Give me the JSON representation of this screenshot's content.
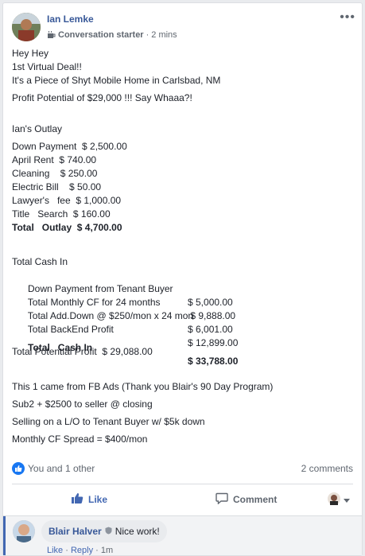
{
  "post": {
    "author": "Ian Lemke",
    "badge": "Conversation starter",
    "separator": "·",
    "time": "2 mins",
    "lines": [
      "Hey Hey",
      "1st Virtual Deal!!",
      "It's a Piece of Shyt Mobile Home in Carlsbad, NM",
      "Profit Potential of $29,000 !!! Say Whaaa?!"
    ],
    "outlay_title": "Ian's Outlay",
    "outlay_items": [
      "Down Payment  $ 2,500.00",
      "April Rent  $ 740.00",
      "Cleaning    $ 250.00",
      "Electric Bill    $ 50.00",
      "Lawyer's   fee  $ 1,000.00",
      "Title   Search  $ 160.00"
    ],
    "outlay_total": "Total   Outlay  $ 4,700.00",
    "cash_title": "Total Cash In",
    "cash_rows": [
      {
        "label": "Down Payment from Tenant Buyer",
        "amount": "$ 5,000.00"
      },
      {
        "label": "Total Monthly CF for 24 months",
        "amount": " $ 9,888.00"
      },
      {
        "label": "Total Add.Down @ $250/mon x 24 mon",
        "amount": "$ 6,001.00"
      },
      {
        "label": "Total BackEnd Profit",
        "amount": "$ 12,899.00"
      }
    ],
    "cash_total_label": "Total   Cash In",
    "cash_total_amount": "$ 33,788.00",
    "potential_profit": "Total Potential Profit  $ 29,088.00",
    "notes": [
      "This 1 came from FB Ads (Thank you Blair's 90 Day Program)",
      "Sub2 + $2500 to seller @ closing",
      "Selling on a L/O to Tenant Buyer w/ $5k down",
      "Monthly CF Spread = $400/mon"
    ]
  },
  "reactions": {
    "summary": "You and 1 other",
    "comments_count": "2 comments"
  },
  "actions": {
    "like": "Like",
    "comment": "Comment"
  },
  "comment": {
    "author": "Blair Halver",
    "text": "Nice work!",
    "like": "Like",
    "reply": "Reply",
    "dot": "·",
    "time": "1m"
  },
  "colors": {
    "link": "#385898",
    "like_blue": "#4267b2",
    "reaction_blue": "#1877f2",
    "muted": "#606770"
  },
  "icons": {
    "more": "more-icon",
    "badge": "coffee-badge-icon",
    "like_reaction": "thumbs-up-icon",
    "like_action": "like-icon",
    "comment_action": "comment-icon",
    "viewer": "viewer-avatar",
    "dropdown": "caret-down-icon",
    "shield": "shield-icon"
  }
}
